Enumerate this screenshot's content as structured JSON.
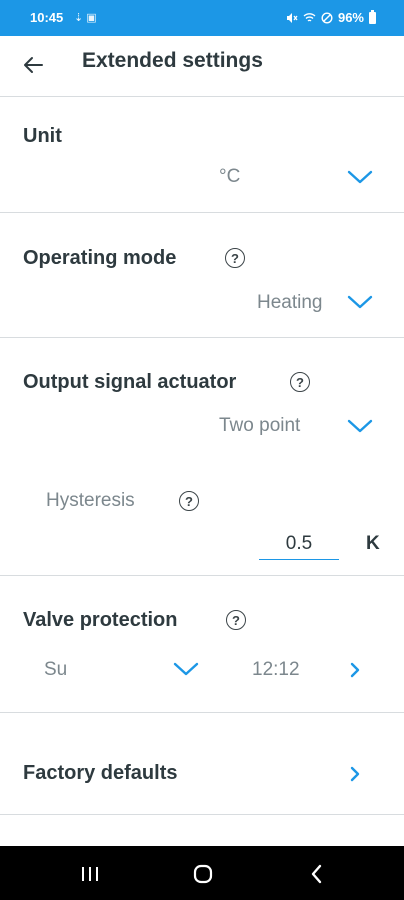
{
  "status_bar": {
    "time": "10:45",
    "notifications": "⇣ ▣",
    "battery": "96%"
  },
  "app_bar": {
    "title": "Extended settings"
  },
  "unit": {
    "label": "Unit",
    "value": "°C"
  },
  "operating_mode": {
    "label": "Operating mode",
    "help": "?",
    "value": "Heating"
  },
  "output_signal": {
    "label": "Output signal actuator",
    "help": "?",
    "value": "Two point",
    "hysteresis": {
      "label": "Hysteresis",
      "help": "?",
      "value": "0.5",
      "unit": "K"
    }
  },
  "valve_protection": {
    "label": "Valve protection",
    "help": "?",
    "day": "Su",
    "time": "12:12"
  },
  "factory_defaults": {
    "label": "Factory defaults"
  },
  "colors": {
    "accent": "#1c97e6",
    "text": "#2e3a3f",
    "muted": "#7c878d",
    "divider": "#d8dcdf"
  },
  "icons": [
    "back-arrow-icon",
    "help-icon",
    "chevron-down-icon",
    "chevron-right-icon",
    "recent-apps-icon",
    "home-icon",
    "back-nav-icon",
    "mute-icon",
    "wifi-icon",
    "dnd-icon",
    "battery-icon"
  ]
}
